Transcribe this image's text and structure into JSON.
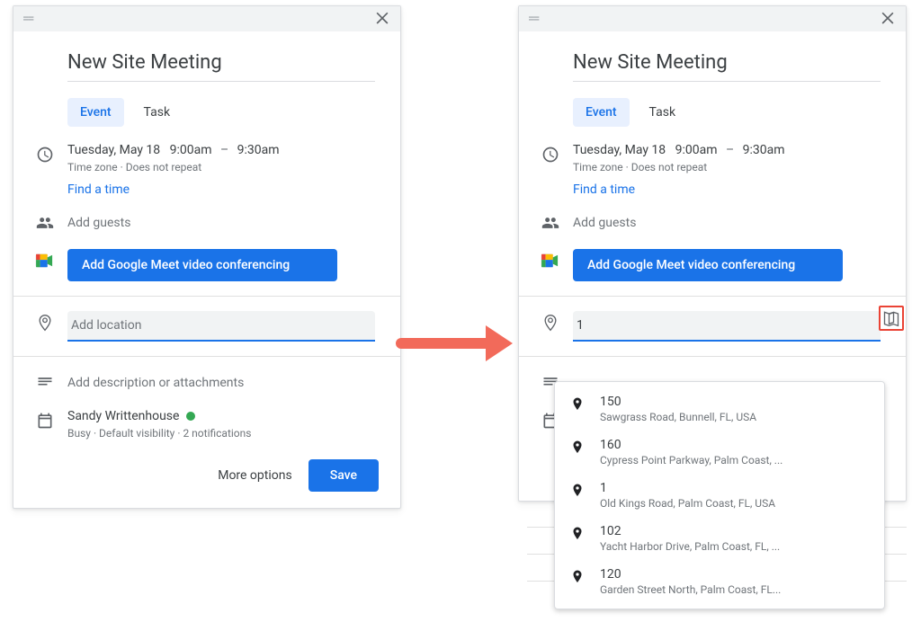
{
  "event": {
    "title": "New Site Meeting",
    "tabs": {
      "event": "Event",
      "task": "Task"
    },
    "datetime": {
      "date": "Tuesday, May 18",
      "start": "9:00am",
      "end": "9:30am",
      "sep": "–"
    },
    "tz_repeat": "Time zone · Does not repeat",
    "find_time": "Find a time",
    "guests_placeholder": "Add guests",
    "meet_button": "Add Google Meet video conferencing",
    "location_placeholder": "Add location",
    "description_placeholder": "Add description or attachments",
    "organizer": {
      "name": "Sandy Writtenhouse",
      "status_line": "Busy · Default visibility · 2 notifications"
    },
    "footer": {
      "more_options": "More options",
      "save": "Save"
    }
  },
  "right": {
    "location_value": "1",
    "suggestions": [
      {
        "main": "150",
        "sub": "Sawgrass Road, Bunnell, FL, USA"
      },
      {
        "main": "160",
        "sub": "Cypress Point Parkway, Palm Coast, ..."
      },
      {
        "main": "1",
        "sub": "Old Kings Road, Palm Coast, FL, USA"
      },
      {
        "main": "102",
        "sub": "Yacht Harbor Drive, Palm Coast, FL, ..."
      },
      {
        "main": "120",
        "sub": "Garden Street North, Palm Coast, FL..."
      }
    ]
  }
}
